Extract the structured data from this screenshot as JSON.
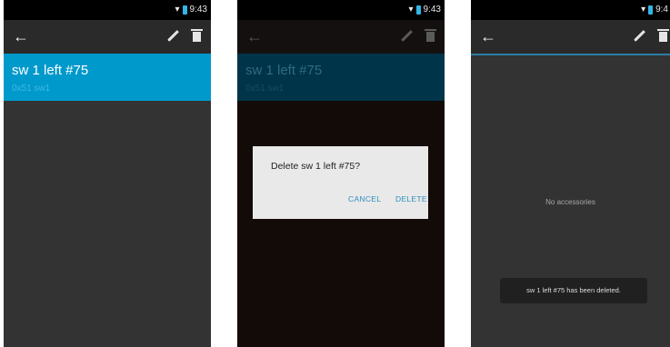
{
  "status_bar": {
    "time": "9:43",
    "time_clipped": "9:4"
  },
  "screens": {
    "detail": {
      "item_title": "sw 1 left #75",
      "item_subtitle": "0x51 sw1"
    },
    "confirm_delete": {
      "item_title": "sw 1 left #75",
      "item_subtitle": "0x51 sw1",
      "dialog_message": "Delete sw 1 left #75?",
      "cancel_label": "CANCEL",
      "delete_label": "DELETE"
    },
    "after_delete": {
      "empty_text": "No accessories",
      "toast_text": "sw 1 left #75 has been deleted."
    }
  },
  "icons": {
    "back": "arrow-left-icon",
    "edit": "pencil-icon",
    "delete": "trash-icon"
  },
  "colors": {
    "accent": "#0099cc",
    "background": "#333333",
    "dialog_bg": "#e9e9e9",
    "status_bar": "#000000"
  }
}
